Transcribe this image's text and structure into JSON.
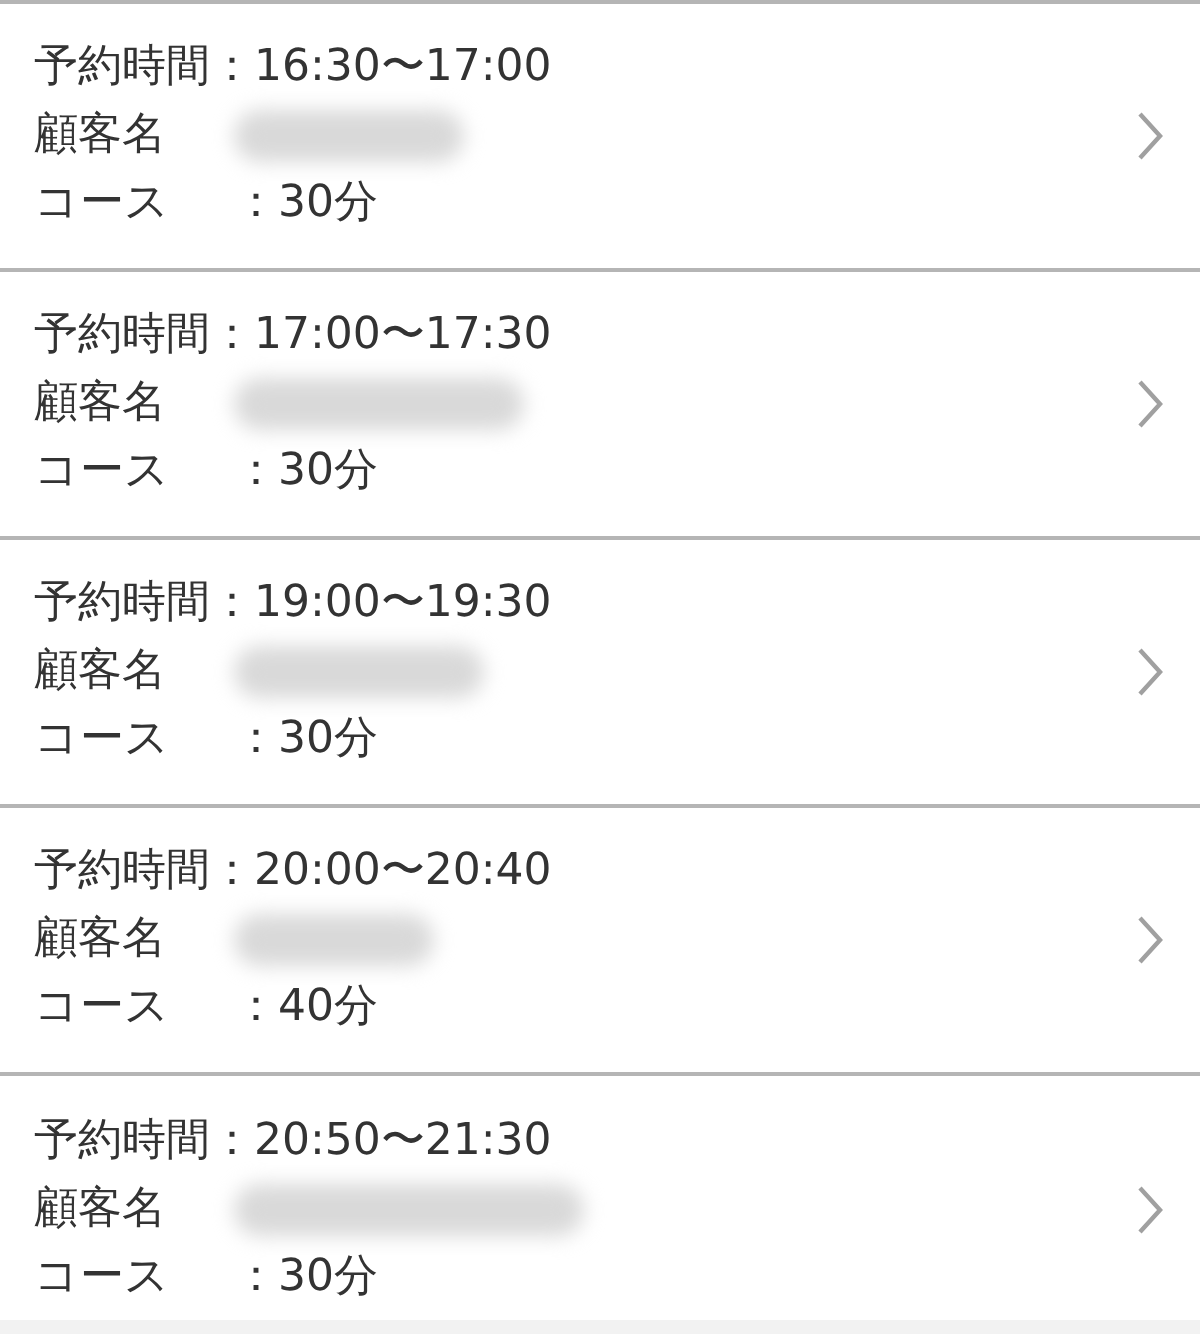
{
  "reservations": [
    {
      "time": "予約時間：16:30〜17:00",
      "customer_label": "顧客名",
      "course_label": "コース",
      "course_value": "：30分"
    },
    {
      "time": "予約時間：17:00〜17:30",
      "customer_label": "顧客名",
      "course_label": "コース",
      "course_value": "：30分"
    },
    {
      "time": "予約時間：19:00〜19:30",
      "customer_label": "顧客名",
      "course_label": "コース",
      "course_value": "：30分"
    },
    {
      "time": "予約時間：20:00〜20:40",
      "customer_label": "顧客名",
      "course_label": "コース",
      "course_value": "：40分"
    },
    {
      "time": "予約時間：20:50〜21:30",
      "customer_label": "顧客名",
      "course_label": "コース",
      "course_value": "：30分"
    }
  ]
}
